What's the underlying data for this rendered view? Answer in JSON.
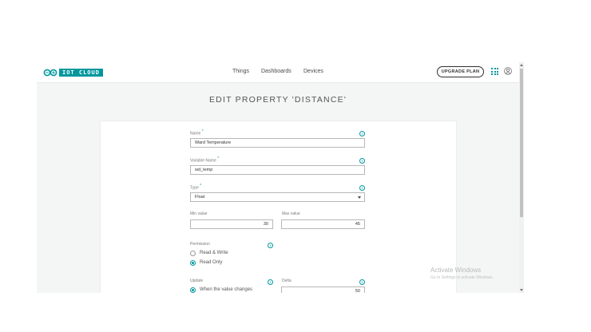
{
  "header": {
    "brand": "IOT CLOUD",
    "nav": [
      "Things",
      "Dashboards",
      "Devices"
    ],
    "upgrade_label": "UPGRADE PLAN"
  },
  "page_title": "EDIT PROPERTY 'DISTANCE'",
  "form": {
    "name": {
      "label": "Name",
      "required": "*",
      "value": "Ward Temperature"
    },
    "variable_name": {
      "label": "Variable Name",
      "required": "*",
      "value": "wd_temp"
    },
    "type": {
      "label": "Type",
      "required": "*",
      "value": "Float"
    },
    "min_value": {
      "label": "Min value",
      "value": "30"
    },
    "max_value": {
      "label": "Max value",
      "value": "45"
    },
    "permission": {
      "label": "Permission",
      "options": [
        "Read & Write",
        "Read Only"
      ],
      "selected": "Read Only"
    },
    "update": {
      "label": "Update",
      "options": [
        "When the value changes"
      ],
      "selected": "When the value changes"
    },
    "delta": {
      "label": "Delta",
      "value": "50"
    }
  },
  "watermark": {
    "title": "Activate Windows",
    "subtitle": "Go to Settings to activate Windows."
  },
  "colors": {
    "accent": "#00979d",
    "background": "#f4f5f5"
  }
}
